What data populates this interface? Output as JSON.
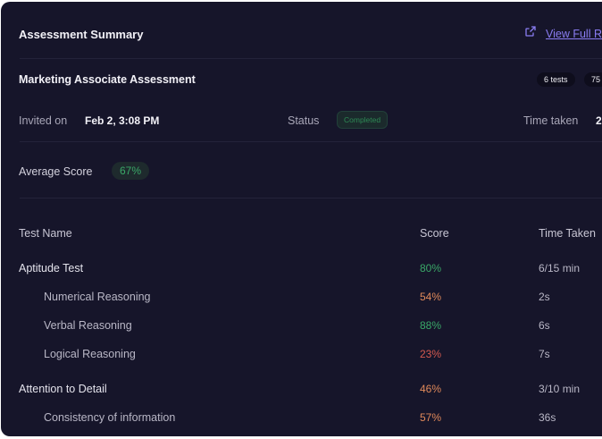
{
  "header": {
    "title": "Assessment Summary",
    "link_label": "View Full R"
  },
  "assessment": {
    "name": "Marketing Associate Assessment",
    "tests_pill": "6 tests",
    "second_pill": "75"
  },
  "meta": {
    "invited_label": "Invited on",
    "invited_value": "Feb 2, 3:08 PM",
    "status_label": "Status",
    "status_value": "Completed",
    "time_label": "Time taken",
    "time_value": "2"
  },
  "average": {
    "label": "Average Score",
    "value": "67%"
  },
  "table": {
    "headers": [
      "Test Name",
      "Score",
      "Time Taken"
    ],
    "rows": [
      {
        "name": "Aptitude Test",
        "score": "80%",
        "time": "6/15 min",
        "level": "main",
        "color": "#3aa868"
      },
      {
        "name": "Numerical Reasoning",
        "score": "54%",
        "time": "2s",
        "level": "sub",
        "color": "#e0895a"
      },
      {
        "name": "Verbal Reasoning",
        "score": "88%",
        "time": "6s",
        "level": "sub",
        "color": "#3aa868"
      },
      {
        "name": "Logical Reasoning",
        "score": "23%",
        "time": "7s",
        "level": "sub",
        "color": "#d55a50"
      },
      {
        "name": "Attention to Detail",
        "score": "46%",
        "time": "3/10 min",
        "level": "main",
        "color": "#e0895a"
      },
      {
        "name": "Consistency of information",
        "score": "57%",
        "time": "36s",
        "level": "sub",
        "color": "#e0895a"
      }
    ]
  },
  "colors": {
    "background": "#16152a",
    "accent": "#8a7df2",
    "good": "#3aa868",
    "warn": "#e0895a",
    "bad": "#d55a50"
  }
}
